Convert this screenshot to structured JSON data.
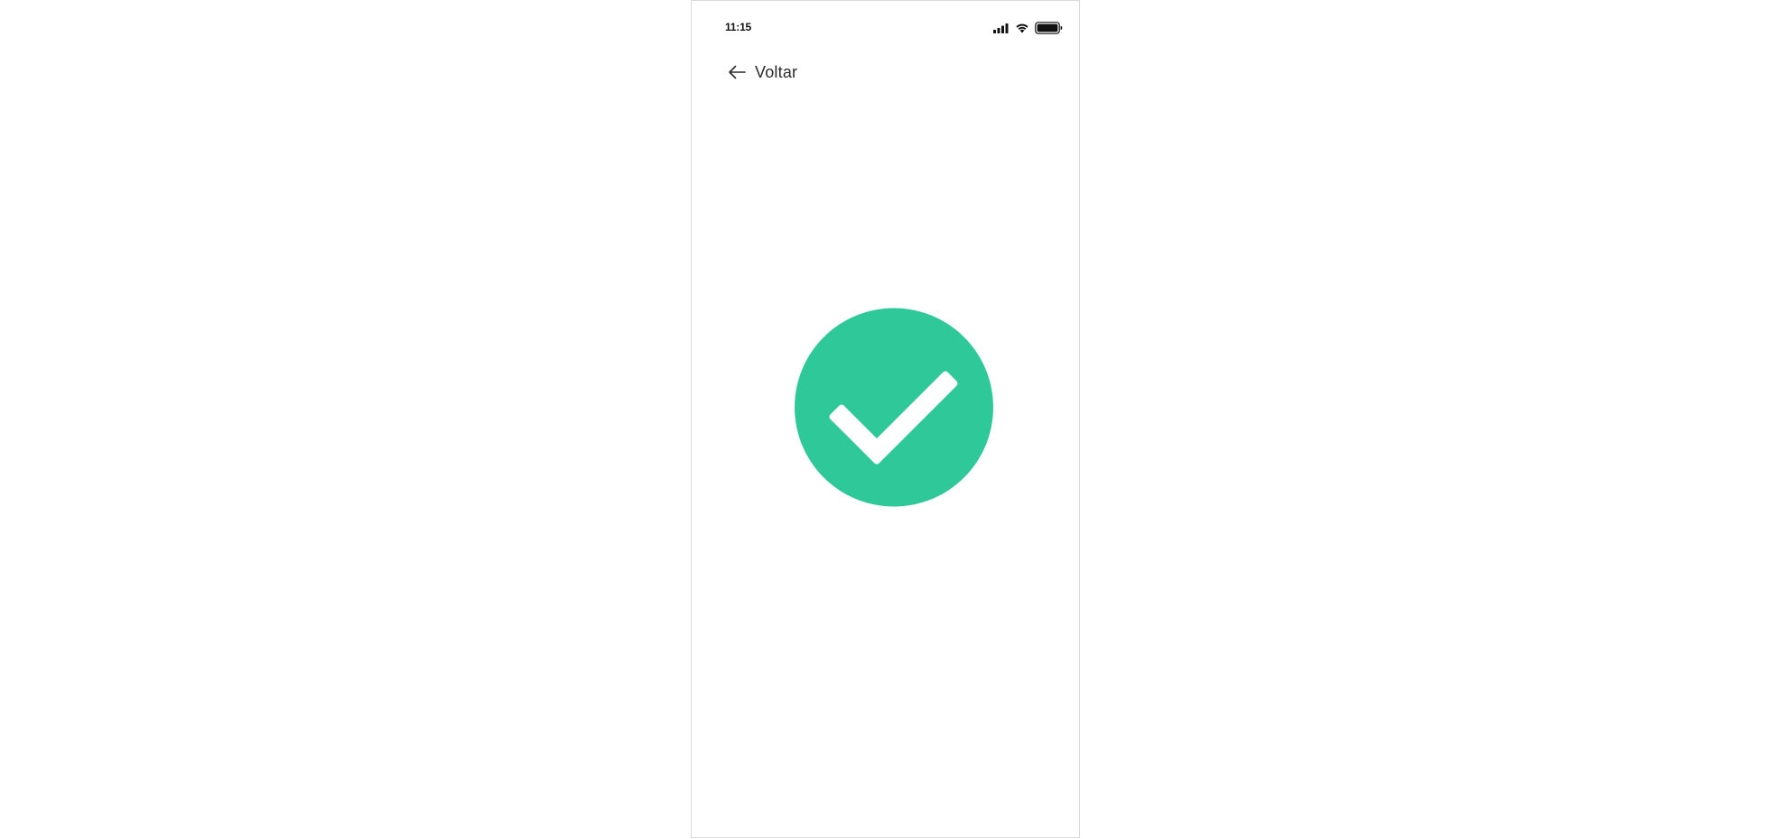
{
  "status_bar": {
    "time": "11:15",
    "icons": [
      "cellular-signal-icon",
      "wifi-icon",
      "battery-icon"
    ]
  },
  "navigation": {
    "back_label": "Voltar",
    "back_icon": "arrow-left-icon"
  },
  "success": {
    "icon": "checkmark-circle-icon",
    "accent_color": "#2FC898",
    "check_color": "#FFFFFF"
  },
  "colors": {
    "background": "#FFFFFF",
    "text": "#2B2B2B",
    "frame_border": "#D9D9D9"
  }
}
